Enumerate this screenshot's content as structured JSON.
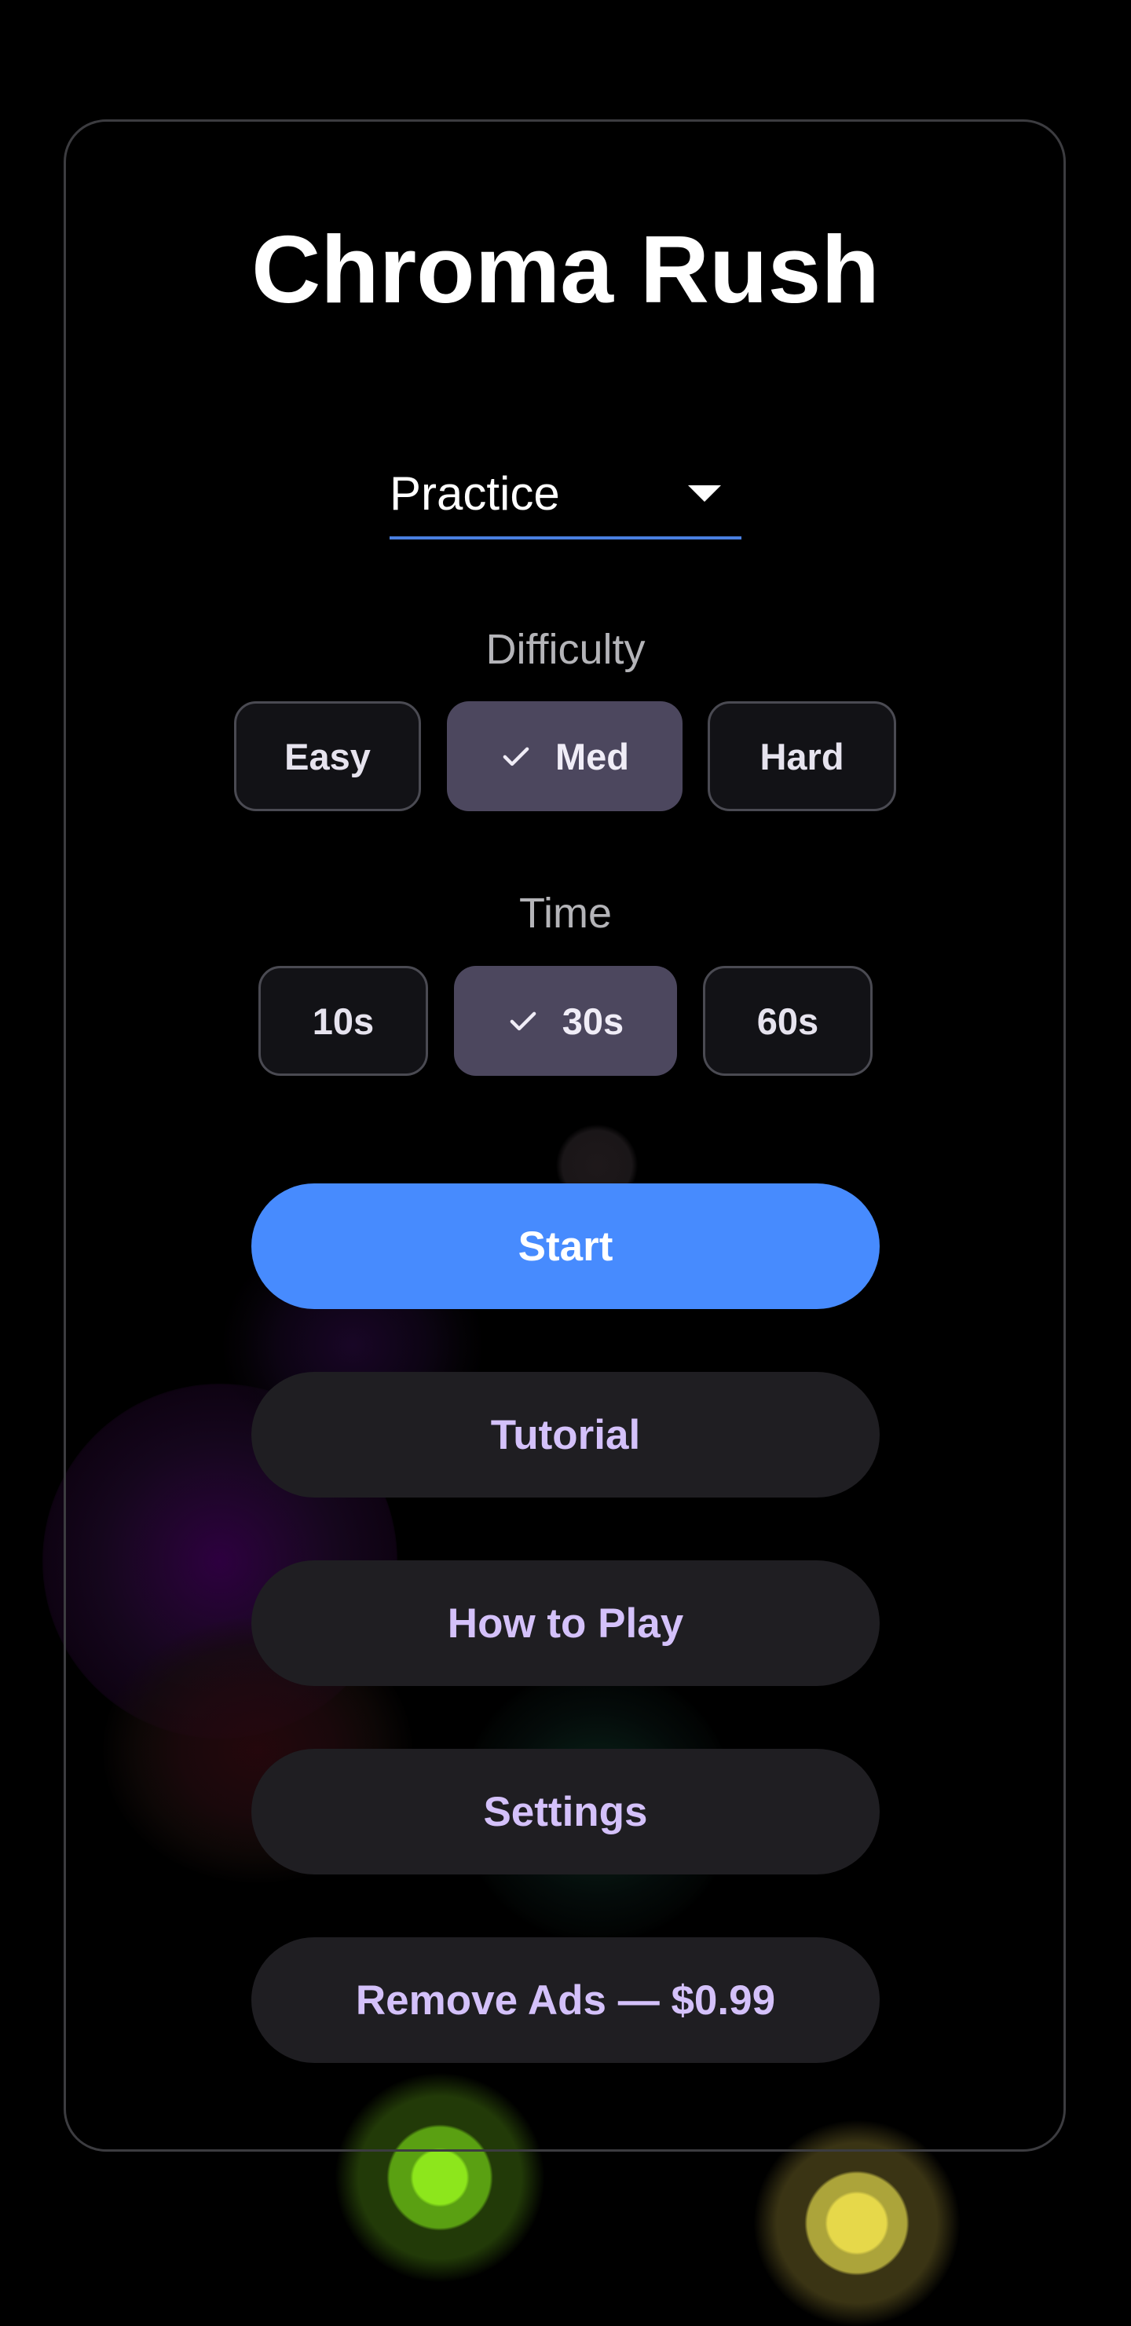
{
  "title": "Chroma Rush",
  "mode_select": {
    "value": "Practice",
    "icon": "caret-down-icon"
  },
  "difficulty": {
    "label": "Difficulty",
    "options": [
      {
        "label": "Easy",
        "selected": false
      },
      {
        "label": "Med",
        "selected": true
      },
      {
        "label": "Hard",
        "selected": false
      }
    ]
  },
  "time": {
    "label": "Time",
    "options": [
      {
        "label": "10s",
        "selected": false
      },
      {
        "label": "30s",
        "selected": true
      },
      {
        "label": "60s",
        "selected": false
      }
    ]
  },
  "buttons": {
    "start": "Start",
    "tutorial": "Tutorial",
    "how_to_play": "How to Play",
    "settings": "Settings",
    "remove_ads": "Remove Ads — $0.99"
  },
  "colors": {
    "background": "#000000",
    "primary": "#478bfe",
    "secondary_button": "#1f1e22",
    "secondary_text": "#d4c1fa",
    "chip_selected": "#4c475e",
    "underline": "#4a7fe0"
  }
}
